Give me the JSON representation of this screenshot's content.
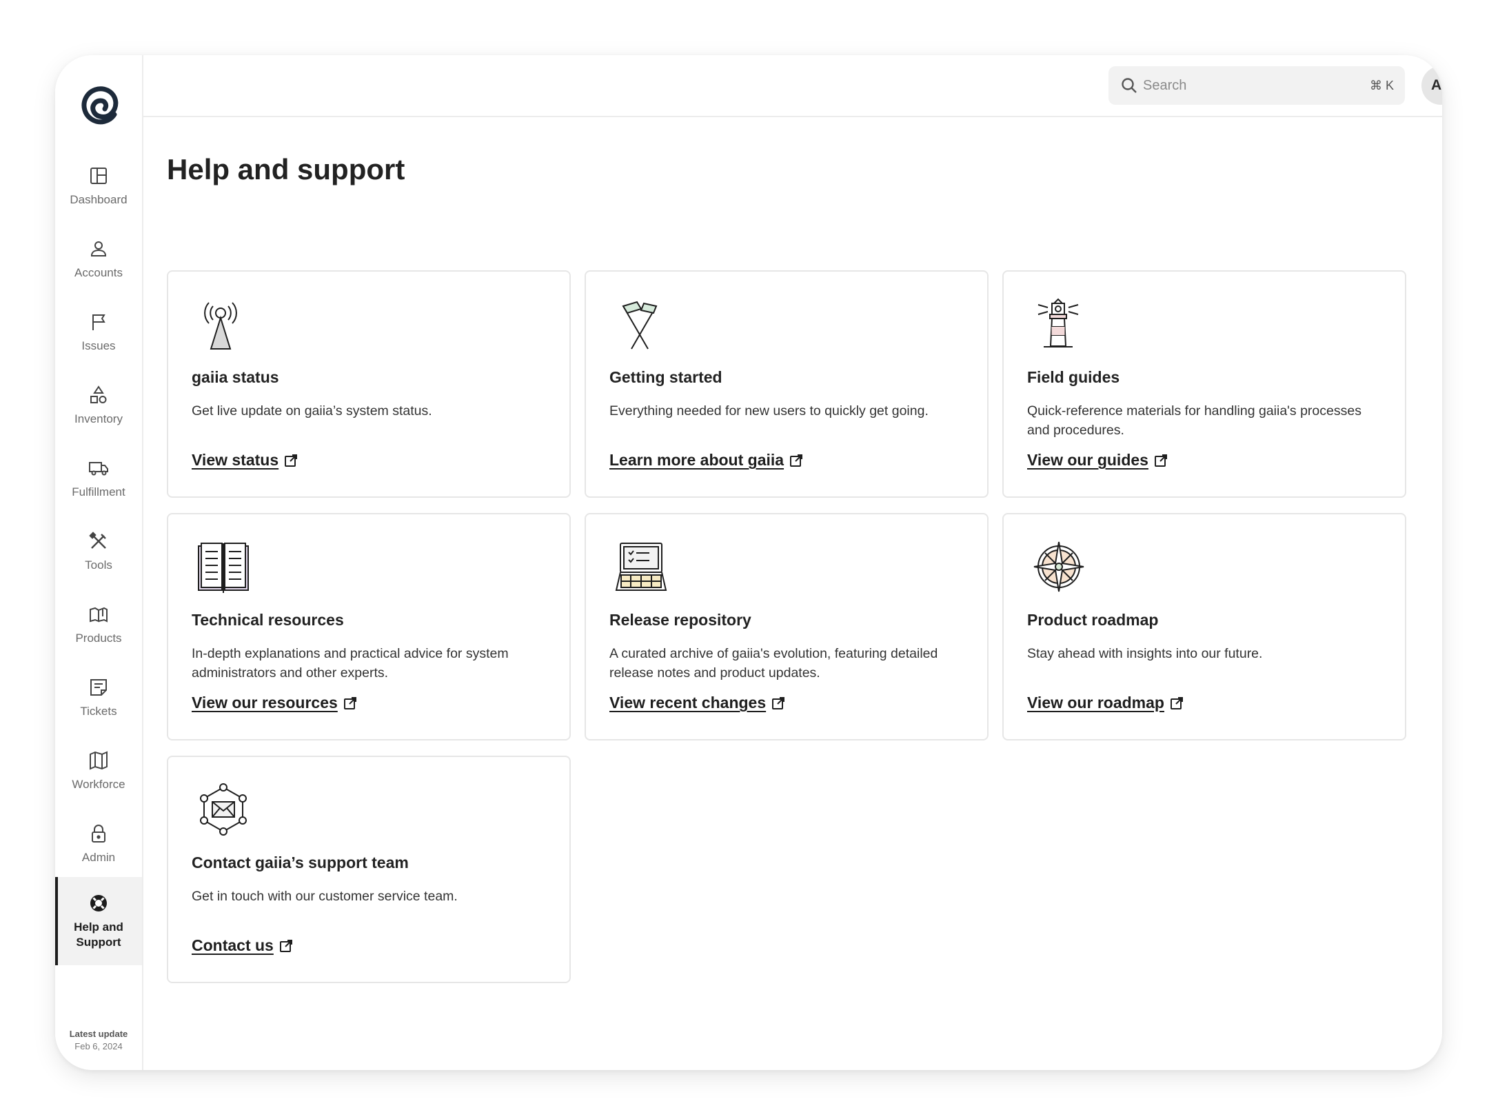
{
  "sidebar": {
    "items": [
      {
        "label": "Dashboard",
        "icon": "dashboard-icon"
      },
      {
        "label": "Accounts",
        "icon": "user-icon"
      },
      {
        "label": "Issues",
        "icon": "flag-icon"
      },
      {
        "label": "Inventory",
        "icon": "shapes-icon"
      },
      {
        "label": "Fulfillment",
        "icon": "truck-icon"
      },
      {
        "label": "Tools",
        "icon": "tools-icon"
      },
      {
        "label": "Products",
        "icon": "box-icon"
      },
      {
        "label": "Tickets",
        "icon": "note-icon"
      },
      {
        "label": "Workforce",
        "icon": "map-icon"
      },
      {
        "label": "Admin",
        "icon": "lock-icon"
      },
      {
        "label": "Help and Support",
        "icon": "lifebuoy-icon",
        "active": true
      }
    ],
    "latest_update_label": "Latest update",
    "latest_update_date": "Feb 6, 2024"
  },
  "header": {
    "search_placeholder": "Search",
    "search_shortcut": "⌘ K",
    "avatar_initials": "AL"
  },
  "page": {
    "title": "Help and support"
  },
  "cards": [
    {
      "title": "gaiia status",
      "description": "Get live update on gaiia’s system status.",
      "link": "View status",
      "icon": "radio-tower-icon"
    },
    {
      "title": "Getting started",
      "description": "Everything needed for new users to quickly get going.",
      "link": "Learn more about gaiia",
      "icon": "crossed-flags-icon"
    },
    {
      "title": "Field guides",
      "description": "Quick-reference materials for handling gaiia's processes and procedures.",
      "link": "View our guides",
      "icon": "lighthouse-icon"
    },
    {
      "title": "Technical resources",
      "description": "In-depth explanations and practical advice for system administrators and other experts.",
      "link": "View our resources",
      "icon": "open-book-icon"
    },
    {
      "title": "Release repository",
      "description": "A curated archive of gaiia's evolution, featuring detailed release notes and product updates.",
      "link": "View recent changes",
      "icon": "laptop-checklist-icon"
    },
    {
      "title": "Product roadmap",
      "description": "Stay ahead with insights into our future.",
      "link": "View our roadmap",
      "icon": "compass-icon"
    },
    {
      "title": "Contact gaiia’s support team",
      "description": "Get in touch with our customer service team.",
      "link": "Contact us",
      "icon": "network-mail-icon"
    }
  ],
  "colors": {
    "accent_dark": "#1d2a3a",
    "border": "#e6e6e6",
    "active_bg": "#f2f2f2"
  }
}
